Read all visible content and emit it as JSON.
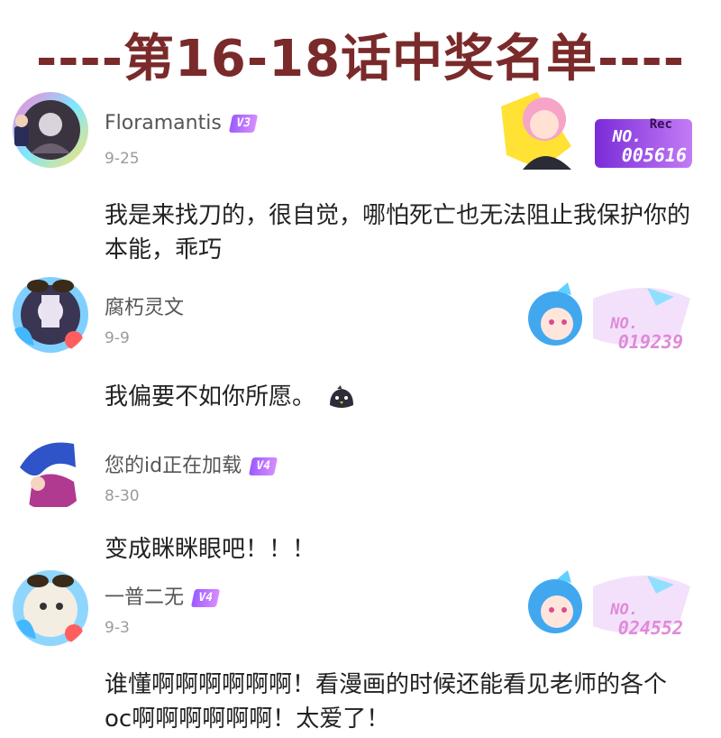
{
  "header": {
    "title": "----第16-18话中奖名单----"
  },
  "comments": [
    {
      "username": "Floramantis",
      "level": "V3",
      "date": "9-25",
      "text": "我是来找刀的，很自觉，哪怕死亡也无法阻止我保护你的本能，乖巧",
      "badge": {
        "no_label": "NO.",
        "number": "005616",
        "rec": "Rec"
      }
    },
    {
      "username": "腐朽灵文",
      "level": "",
      "date": "9-9",
      "text": "我偏要不如你所愿。",
      "emoji_icon": "cute-bird-emoji-icon",
      "badge": {
        "no_label": "NO.",
        "number": "019239"
      }
    },
    {
      "username": "您的id正在加载",
      "level": "V4",
      "date": "8-30",
      "text": "变成眯眯眼吧！！！"
    },
    {
      "username": "一普二无",
      "level": "V4",
      "date": "9-3",
      "text": "谁懂啊啊啊啊啊啊！看漫画的时候还能看见老师的各个oc啊啊啊啊啊啊！太爱了！",
      "badge": {
        "no_label": "NO.",
        "number": "024552"
      }
    }
  ],
  "colors": {
    "title": "#7a2a2a",
    "vip_badge": "#b06cff",
    "date": "#9b9b9b",
    "text": "#222222"
  }
}
